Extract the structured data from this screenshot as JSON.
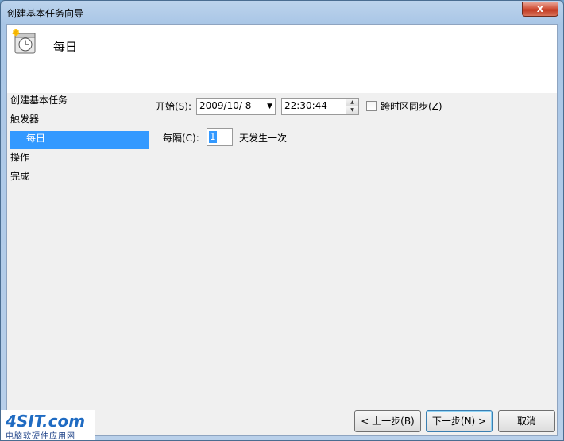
{
  "window": {
    "title": "创建基本任务向导",
    "close_label": "x"
  },
  "header": {
    "title": "每日",
    "icon": "calendar-clock-icon"
  },
  "sidebar": {
    "items": [
      {
        "label": "创建基本任务"
      },
      {
        "label": "触发器"
      },
      {
        "label": "每日"
      },
      {
        "label": "操作"
      },
      {
        "label": "完成"
      }
    ],
    "selected": "每日"
  },
  "form": {
    "start_label": "开始(S):",
    "start_date": "2009/10/  8",
    "start_time": "22:30:44",
    "sync_label": "跨时区同步(Z)",
    "sync_checked": false,
    "interval_label": "每隔(C):",
    "interval_value": "1",
    "interval_suffix": "天发生一次"
  },
  "buttons": {
    "back": "< 上一步(B)",
    "next": "下一步(N) >",
    "cancel": "取消"
  },
  "watermark": {
    "logo": "4SIT.com",
    "subtitle": "电脑软硬件应用网"
  },
  "colors": {
    "selection": "#3399ff",
    "title_bar": "#b9d1ea"
  }
}
